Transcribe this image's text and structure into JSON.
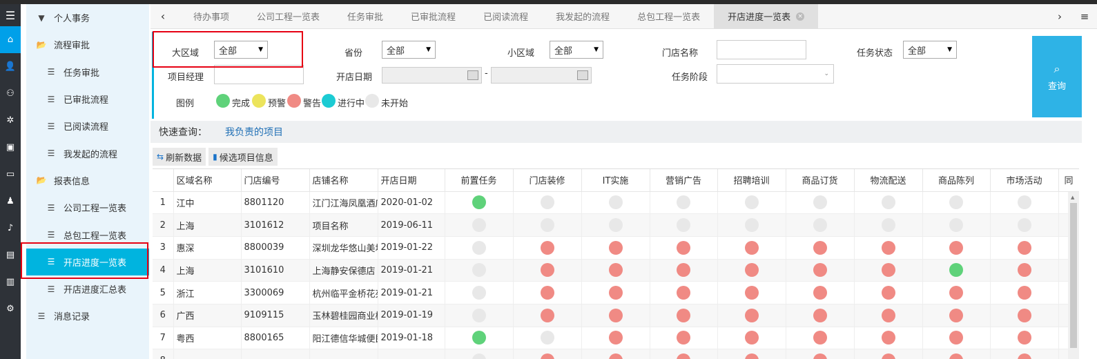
{
  "icon_rail": [
    {
      "name": "menu-icon",
      "glyph": "☰"
    },
    {
      "name": "home-icon",
      "glyph": "⌂"
    },
    {
      "name": "user-settings-icon",
      "glyph": "👤"
    },
    {
      "name": "group-icon",
      "glyph": "⚇"
    },
    {
      "name": "network-icon",
      "glyph": "✲"
    },
    {
      "name": "window-icon",
      "glyph": "▣"
    },
    {
      "name": "money-icon",
      "glyph": "▭"
    },
    {
      "name": "person-icon",
      "glyph": "♟"
    },
    {
      "name": "bell-icon",
      "glyph": "♪"
    },
    {
      "name": "print-icon",
      "glyph": "▤"
    },
    {
      "name": "report-icon",
      "glyph": "▥"
    },
    {
      "name": "gear-icon",
      "glyph": "⚙"
    }
  ],
  "sidebar": {
    "items": [
      {
        "label": "个人事务",
        "icon": "caret-down-icon",
        "glyph": "▼",
        "level": 0
      },
      {
        "label": "流程审批",
        "icon": "folder-open-icon",
        "glyph": "📂",
        "level": 0
      },
      {
        "label": "任务审批",
        "icon": "list-icon",
        "glyph": "☰",
        "level": 1
      },
      {
        "label": "已审批流程",
        "icon": "list-icon",
        "glyph": "☰",
        "level": 1
      },
      {
        "label": "已阅读流程",
        "icon": "list-icon",
        "glyph": "☰",
        "level": 1
      },
      {
        "label": "我发起的流程",
        "icon": "list-icon",
        "glyph": "☰",
        "level": 1
      },
      {
        "label": "报表信息",
        "icon": "folder-open-icon",
        "glyph": "📂",
        "level": 0
      },
      {
        "label": "公司工程一览表",
        "icon": "list-icon",
        "glyph": "☰",
        "level": 1
      },
      {
        "label": "总包工程一览表",
        "icon": "list-icon",
        "glyph": "☰",
        "level": 1
      },
      {
        "label": "开店进度一览表",
        "icon": "list-icon",
        "glyph": "☰",
        "level": 1,
        "active": true
      },
      {
        "label": "开店进度汇总表",
        "icon": "list-icon",
        "glyph": "☰",
        "level": 1
      },
      {
        "label": "消息记录",
        "icon": "list-icon",
        "glyph": "☰",
        "level": 0
      }
    ]
  },
  "tabs": {
    "prev_glyph": "‹",
    "next_glyph": "›",
    "menu_glyph": "≡",
    "items": [
      {
        "label": "待办事项"
      },
      {
        "label": "公司工程一览表"
      },
      {
        "label": "任务审批"
      },
      {
        "label": "已审批流程"
      },
      {
        "label": "已阅读流程"
      },
      {
        "label": "我发起的流程"
      },
      {
        "label": "总包工程一览表"
      },
      {
        "label": "开店进度一览表",
        "active": true
      }
    ],
    "close_glyph": "×"
  },
  "filter": {
    "region_label": "大区域",
    "region_value": "全部",
    "province_label": "省份",
    "province_value": "全部",
    "subregion_label": "小区域",
    "subregion_value": "全部",
    "store_name_label": "门店名称",
    "store_name_value": "",
    "task_status_label": "任务状态",
    "task_status_value": "全部",
    "pm_label": "项目经理",
    "pm_value": "",
    "open_date_label": "开店日期",
    "date_sep": "-",
    "task_stage_label": "任务阶段",
    "task_stage_value": "",
    "legend_label": "图例",
    "legend": [
      {
        "label": "完成",
        "color": "#5fd27a"
      },
      {
        "label": "预警",
        "color": "#ece45c"
      },
      {
        "label": "警告",
        "color": "#f08a84"
      },
      {
        "label": "进行中",
        "color": "#1ccbd3"
      },
      {
        "label": "未开始",
        "color": "#e8e8e8"
      }
    ],
    "search_label": "查询",
    "search_glyph": "⌕"
  },
  "quick": {
    "label": "快速查询：",
    "link": "我负责的项目"
  },
  "toolbar": {
    "refresh_label": "刷新数据",
    "refresh_glyph": "⇆",
    "candidate_label": "候选项目信息",
    "candidate_glyph": "▮"
  },
  "status_colors": {
    "done": "#5fd27a",
    "warn": "#f08a84",
    "none": "#e8e8e8"
  },
  "table": {
    "columns": [
      "",
      "区域名称",
      "门店编号",
      "店铺名称",
      "开店日期",
      "前置任务",
      "门店装修",
      "IT实施",
      "营销广告",
      "招聘培训",
      "商品订货",
      "物流配送",
      "商品陈列",
      "市场活动",
      "同"
    ],
    "rows": [
      {
        "no": "1",
        "region": "江中",
        "code": "8801120",
        "store": "江门江海凤凰酒店",
        "date": "2020-01-02",
        "status": [
          "done",
          "none",
          "none",
          "none",
          "none",
          "none",
          "none",
          "none",
          "none"
        ]
      },
      {
        "no": "2",
        "region": "上海",
        "code": "3101612",
        "store": "项目名称",
        "date": "2019-06-11",
        "status": [
          "none",
          "none",
          "none",
          "none",
          "none",
          "none",
          "none",
          "none",
          "none"
        ]
      },
      {
        "no": "3",
        "region": "惠深",
        "code": "8800039",
        "store": "深圳龙华悠山美地",
        "date": "2019-01-22",
        "status": [
          "none",
          "warn",
          "warn",
          "warn",
          "warn",
          "warn",
          "warn",
          "warn",
          "warn"
        ]
      },
      {
        "no": "4",
        "region": "上海",
        "code": "3101610",
        "store": "上海静安保德店",
        "date": "2019-01-21",
        "status": [
          "none",
          "warn",
          "warn",
          "warn",
          "warn",
          "warn",
          "warn",
          "done",
          "warn"
        ]
      },
      {
        "no": "5",
        "region": "浙江",
        "code": "3300069",
        "store": "杭州临平金桥花苑",
        "date": "2019-01-21",
        "status": [
          "none",
          "warn",
          "warn",
          "warn",
          "warn",
          "warn",
          "warn",
          "warn",
          "warn"
        ]
      },
      {
        "no": "6",
        "region": "广西",
        "code": "9109115",
        "store": "玉林碧桂园商业楼",
        "date": "2019-01-19",
        "status": [
          "none",
          "warn",
          "warn",
          "warn",
          "warn",
          "warn",
          "warn",
          "warn",
          "warn"
        ]
      },
      {
        "no": "7",
        "region": "粤西",
        "code": "8800165",
        "store": "阳江德信华城便民",
        "date": "2019-01-18",
        "status": [
          "done",
          "none",
          "warn",
          "warn",
          "warn",
          "warn",
          "warn",
          "warn",
          "warn"
        ]
      },
      {
        "no": "8",
        "region": "",
        "code": "",
        "store": "",
        "date": "",
        "status": [
          "none",
          "warn",
          "warn",
          "warn",
          "warn",
          "warn",
          "warn",
          "warn",
          "warn"
        ]
      }
    ]
  }
}
